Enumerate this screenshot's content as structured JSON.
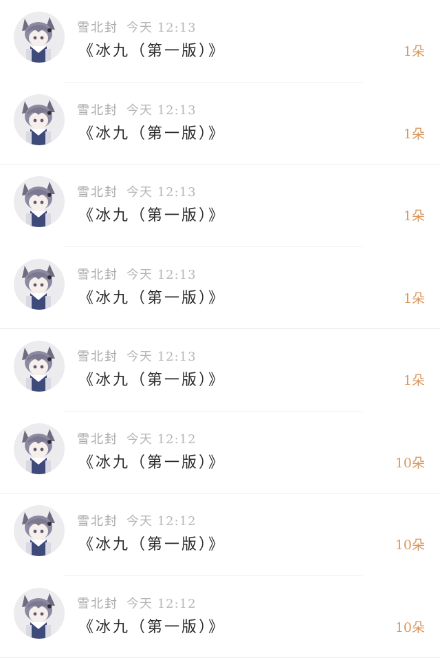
{
  "gifts": [
    {
      "sender": "雪北封",
      "time": "今天 12:13",
      "title": "《冰九（第一版）》",
      "count": "1朵"
    },
    {
      "sender": "雪北封",
      "time": "今天 12:13",
      "title": "《冰九（第一版）》",
      "count": "1朵"
    },
    {
      "sender": "雪北封",
      "time": "今天 12:13",
      "title": "《冰九（第一版）》",
      "count": "1朵"
    },
    {
      "sender": "雪北封",
      "time": "今天 12:13",
      "title": "《冰九（第一版）》",
      "count": "1朵"
    },
    {
      "sender": "雪北封",
      "time": "今天 12:13",
      "title": "《冰九（第一版）》",
      "count": "1朵"
    },
    {
      "sender": "雪北封",
      "time": "今天 12:12",
      "title": "《冰九（第一版）》",
      "count": "10朵"
    },
    {
      "sender": "雪北封",
      "time": "今天 12:12",
      "title": "《冰九（第一版）》",
      "count": "10朵"
    },
    {
      "sender": "雪北封",
      "time": "今天 12:12",
      "title": "《冰九（第一版）》",
      "count": "10朵"
    }
  ],
  "colors": {
    "count_accent": "#d9975c",
    "meta_gray": "#a9a9a9",
    "title_dark": "#2b2b2b"
  },
  "avatar_icon": "cat-ear-anime-avatar-icon"
}
